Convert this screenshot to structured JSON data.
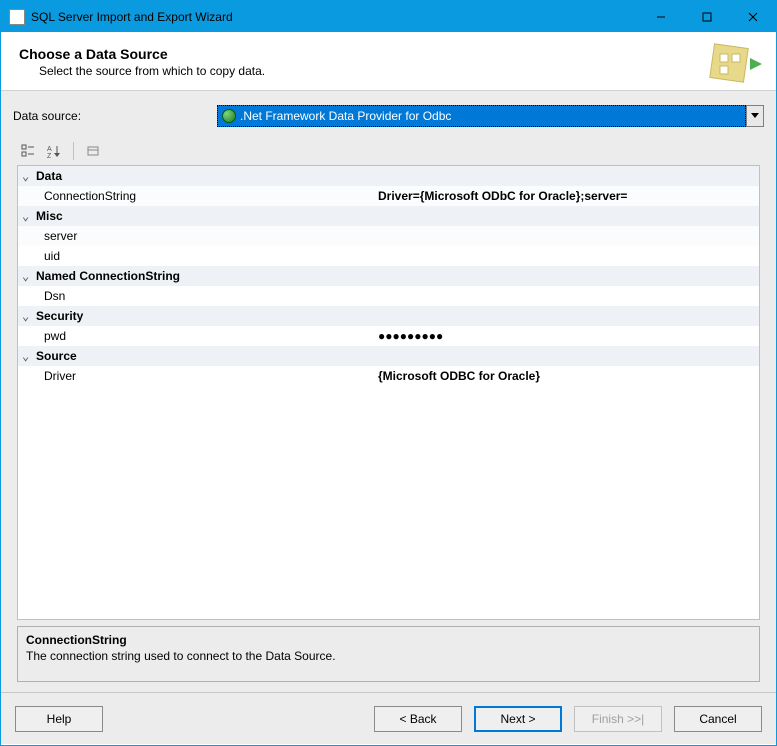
{
  "window": {
    "title": "SQL Server Import and Export Wizard"
  },
  "header": {
    "title": "Choose a Data Source",
    "subtitle": "Select the source from which to copy data."
  },
  "dataSource": {
    "label": "Data source:",
    "selected": ".Net Framework Data Provider for Odbc"
  },
  "propertyGrid": {
    "categories": [
      {
        "name": "Data",
        "properties": [
          {
            "name": "ConnectionString",
            "value": "Driver={Microsoft ODbC for Oracle};server=",
            "bold": true
          }
        ]
      },
      {
        "name": "Misc",
        "properties": [
          {
            "name": "server",
            "value": ""
          },
          {
            "name": "uid",
            "value": ""
          }
        ]
      },
      {
        "name": "Named ConnectionString",
        "properties": [
          {
            "name": "Dsn",
            "value": ""
          }
        ]
      },
      {
        "name": "Security",
        "properties": [
          {
            "name": "pwd",
            "value": "●●●●●●●●●",
            "bold": true
          }
        ]
      },
      {
        "name": "Source",
        "properties": [
          {
            "name": "Driver",
            "value": "{Microsoft ODBC for Oracle}",
            "bold": true
          }
        ]
      }
    ]
  },
  "description": {
    "title": "ConnectionString",
    "text": "The connection string used to connect to the Data Source."
  },
  "buttons": {
    "help": "Help",
    "back": "< Back",
    "next": "Next >",
    "finish": "Finish >>|",
    "cancel": "Cancel"
  }
}
